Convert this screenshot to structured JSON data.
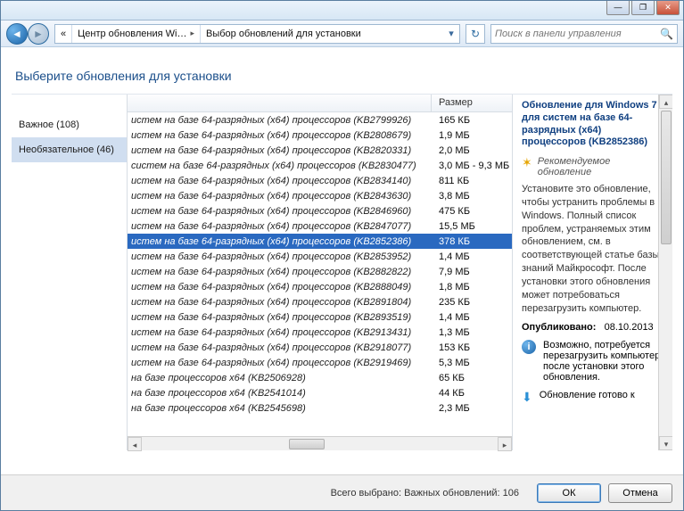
{
  "titlebar": {
    "minimize": "—",
    "maximize": "❐",
    "close": "✕"
  },
  "nav": {
    "back_glyph": "◄",
    "fwd_glyph": "►",
    "bc_root_glyph": "«",
    "bc1": "Центр обновления Wi…",
    "bc2": "Выбор обновлений для установки",
    "drop_glyph": "▾",
    "refresh_glyph": "↻",
    "search_placeholder": "Поиск в панели управления",
    "search_glyph": "🔍"
  },
  "page_title": "Выберите обновления для установки",
  "sidebar": {
    "items": [
      {
        "label": "Важное (108)",
        "selected": false
      },
      {
        "label": "Необязательное (46)",
        "selected": true
      }
    ]
  },
  "columns": {
    "name": "",
    "size": "Размер"
  },
  "updates": [
    {
      "name": "истем на базе 64-разрядных (x64) процессоров (KB2799926)",
      "size": "165 КБ",
      "sel": false
    },
    {
      "name": "истем на базе 64-разрядных (x64) процессоров (KB2808679)",
      "size": "1,9 МБ",
      "sel": false
    },
    {
      "name": "истем на базе 64-разрядных (x64) процессоров (KB2820331)",
      "size": "2,0 МБ",
      "sel": false
    },
    {
      "name": "систем на базе 64-разрядных (x64) процессоров (KB2830477)",
      "size": "3,0 МБ - 9,3 МБ",
      "sel": false
    },
    {
      "name": "истем на базе 64-разрядных (x64) процессоров (KB2834140)",
      "size": "811 КБ",
      "sel": false
    },
    {
      "name": "истем на базе 64-разрядных (x64) процессоров (KB2843630)",
      "size": "3,8 МБ",
      "sel": false
    },
    {
      "name": "истем на базе 64-разрядных (x64) процессоров (KB2846960)",
      "size": "475 КБ",
      "sel": false
    },
    {
      "name": "истем на базе 64-разрядных (x64) процессоров (KB2847077)",
      "size": "15,5 МБ",
      "sel": false
    },
    {
      "name": "истем на базе 64-разрядных (x64) процессоров (KB2852386)",
      "size": "378 КБ",
      "sel": true
    },
    {
      "name": "истем на базе 64-разрядных (x64) процессоров (KB2853952)",
      "size": "1,4 МБ",
      "sel": false
    },
    {
      "name": "истем на базе 64-разрядных (x64) процессоров (KB2882822)",
      "size": "7,9 МБ",
      "sel": false
    },
    {
      "name": "истем на базе 64-разрядных (x64) процессоров (KB2888049)",
      "size": "1,8 МБ",
      "sel": false
    },
    {
      "name": "истем на базе 64-разрядных (x64) процессоров (KB2891804)",
      "size": "235 КБ",
      "sel": false
    },
    {
      "name": "истем на базе 64-разрядных (x64) процессоров (KB2893519)",
      "size": "1,4 МБ",
      "sel": false
    },
    {
      "name": "истем на базе 64-разрядных (x64) процессоров (KB2913431)",
      "size": "1,3 МБ",
      "sel": false
    },
    {
      "name": "истем на базе 64-разрядных (x64) процессоров (KB2918077)",
      "size": "153 КБ",
      "sel": false
    },
    {
      "name": "истем на базе 64-разрядных (x64) процессоров (KB2919469)",
      "size": "5,3 МБ",
      "sel": false
    },
    {
      "name": "на базе процессоров x64 (KB2506928)",
      "size": "65 КБ",
      "sel": false
    },
    {
      "name": "на базе процессоров x64 (KB2541014)",
      "size": "44 КБ",
      "sel": false
    },
    {
      "name": "на базе процессоров x64 (KB2545698)",
      "size": "2,3 МБ",
      "sel": false
    }
  ],
  "details": {
    "title_bold": "Обновление для Windows 7 для систем на базе 64-разрядных (x64) процессоров (KB2852386)",
    "recommended": "Рекомендуемое обновление",
    "description": "Установите это обновление, чтобы устранить проблемы в Windows. Полный список проблем, устраняемых этим обновлением, см. в соответствующей статье базы знаний Майкрософт. После установки этого обновления может потребоваться перезагрузить компьютер.",
    "published_label": "Опубликовано:",
    "published_value": "08.10.2013",
    "restart_note": "Возможно, потребуется перезагрузить компьютер после установки этого обновления.",
    "ready_label": "Обновление готово к"
  },
  "footer": {
    "summary": "Всего выбрано: Важных обновлений: 106",
    "ok": "ОК",
    "cancel": "Отмена"
  }
}
